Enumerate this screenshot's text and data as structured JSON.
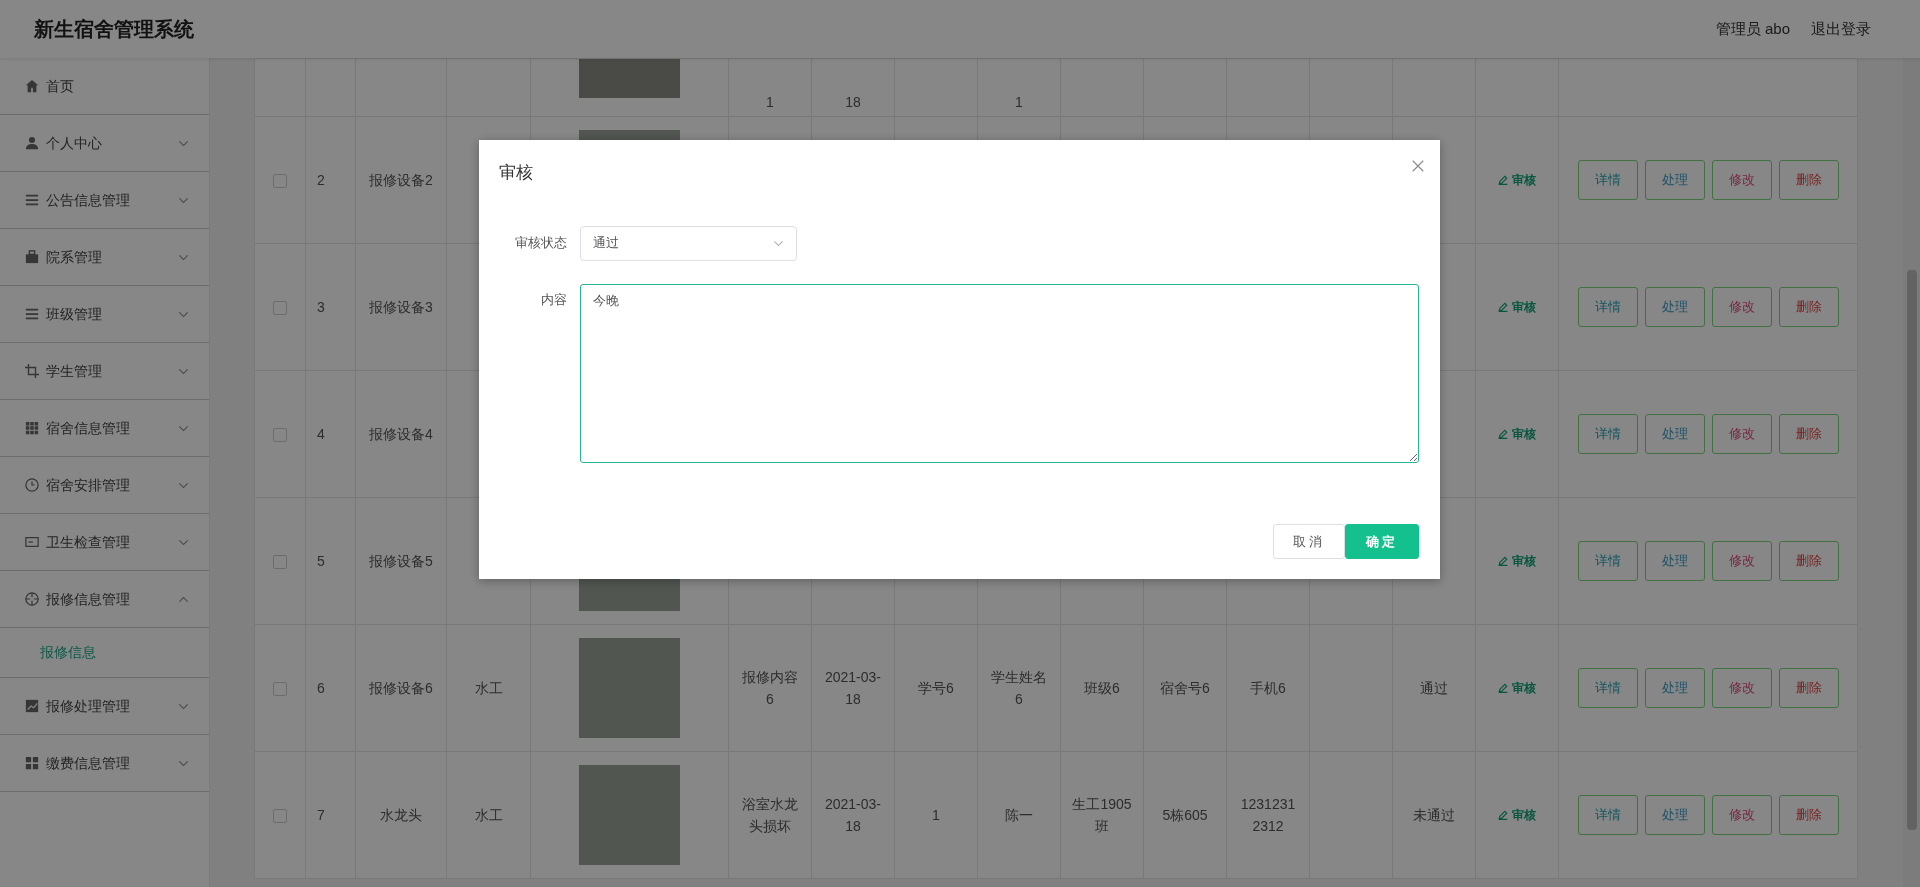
{
  "header": {
    "title": "新生宿舍管理系统",
    "user": "管理员 abo",
    "logout": "退出登录"
  },
  "sidebar": {
    "items": [
      {
        "label": "首页",
        "kind": "link"
      },
      {
        "label": "个人中心",
        "kind": "group",
        "expanded": false
      },
      {
        "label": "公告信息管理",
        "kind": "group",
        "expanded": false
      },
      {
        "label": "院系管理",
        "kind": "group",
        "expanded": false
      },
      {
        "label": "班级管理",
        "kind": "group",
        "expanded": false
      },
      {
        "label": "学生管理",
        "kind": "group",
        "expanded": false
      },
      {
        "label": "宿舍信息管理",
        "kind": "group",
        "expanded": false
      },
      {
        "label": "宿舍安排管理",
        "kind": "group",
        "expanded": false
      },
      {
        "label": "卫生检查管理",
        "kind": "group",
        "expanded": false
      },
      {
        "label": "报修信息管理",
        "kind": "group",
        "expanded": true,
        "children": [
          {
            "label": "报修信息",
            "selected": true
          }
        ]
      },
      {
        "label": "报修处理管理",
        "kind": "group",
        "expanded": false
      },
      {
        "label": "缴费信息管理",
        "kind": "group",
        "expanded": false
      }
    ]
  },
  "table": {
    "rows": [
      {
        "kind": "clipped",
        "content": "1",
        "date": "18",
        "student_name": "1"
      },
      {
        "kind": "full",
        "checked": false,
        "index": "2",
        "name": "报修设备2",
        "audit": "审核",
        "actions": [
          "详情",
          "处理",
          "修改",
          "删除"
        ]
      },
      {
        "kind": "full",
        "checked": false,
        "index": "3",
        "name": "报修设备3",
        "audit": "审核",
        "actions": [
          "详情",
          "处理",
          "修改",
          "删除"
        ]
      },
      {
        "kind": "full",
        "checked": false,
        "index": "4",
        "name": "报修设备4",
        "audit": "审核",
        "actions": [
          "详情",
          "处理",
          "修改",
          "删除"
        ]
      },
      {
        "kind": "full",
        "checked": false,
        "index": "5",
        "name": "报修设备5",
        "audit": "审核",
        "actions": [
          "详情",
          "处理",
          "修改",
          "删除"
        ]
      },
      {
        "kind": "full",
        "checked": false,
        "index": "6",
        "name": "报修设备6",
        "type": "水工",
        "content": "报修内容6",
        "date": "2021-03-18",
        "student_no": "学号6",
        "student_name": "学生姓名6",
        "class": "班级6",
        "dorm": "宿舍号6",
        "phone": "手机6",
        "status": "通过",
        "audit": "审核",
        "actions": [
          "详情",
          "处理",
          "修改",
          "删除"
        ]
      },
      {
        "kind": "full",
        "checked": false,
        "index": "7",
        "name": "水龙头",
        "type": "水工",
        "content": "浴室水龙头损坏",
        "date": "2021-03-18",
        "student_no": "1",
        "student_name": "陈一",
        "class": "生工1905班",
        "dorm": "5栋605",
        "phone": "12312312312",
        "status": "未通过",
        "audit": "审核",
        "actions": [
          "详情",
          "处理",
          "修改",
          "删除"
        ]
      }
    ]
  },
  "dialog": {
    "title": "审核",
    "fields": [
      {
        "kind": "select",
        "label": "审核状态",
        "value": "通过"
      },
      {
        "kind": "textarea",
        "label": "内容",
        "value": "今晚"
      }
    ],
    "buttons": [
      {
        "label": "取消",
        "kind": "default"
      },
      {
        "label": "确定",
        "kind": "primary"
      }
    ]
  }
}
